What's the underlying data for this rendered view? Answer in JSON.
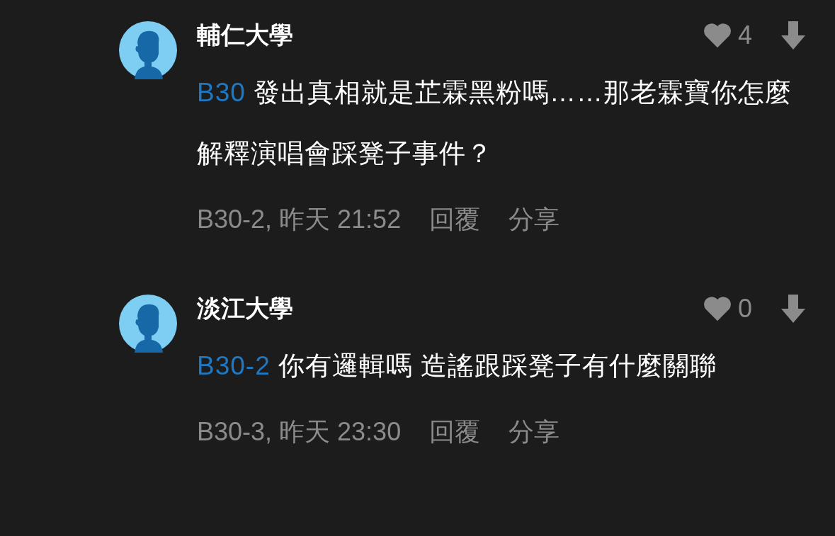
{
  "comments": [
    {
      "author": "輔仁大學",
      "likes": "4",
      "reply_to": "B30",
      "text": "發出真相就是芷霖黑粉嗎……那老霖寶你怎麼解釋演唱會踩凳子事件？",
      "floor_time": "B30-2, 昨天 21:52",
      "actions": [
        "回覆",
        "分享"
      ]
    },
    {
      "author": "淡江大學",
      "likes": "0",
      "reply_to": "B30-2",
      "text": "你有邏輯嗎 造謠跟踩凳子有什麼關聯",
      "floor_time": "B30-3, 昨天 23:30",
      "actions": [
        "回覆",
        "分享"
      ]
    }
  ]
}
